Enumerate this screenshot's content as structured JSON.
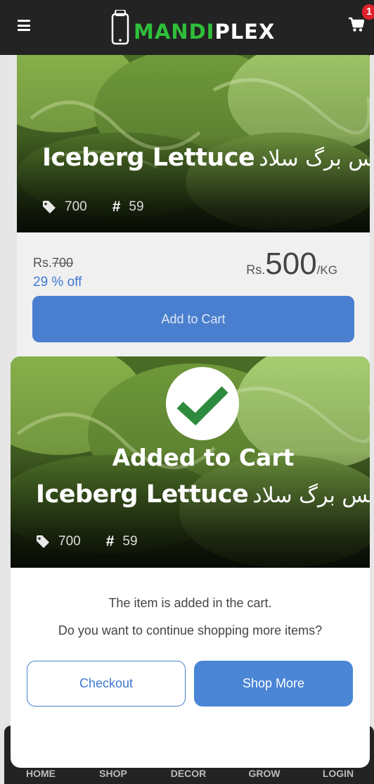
{
  "header": {
    "brand_part1": "MANDI",
    "brand_part2": "PLEX",
    "cart_count": "1",
    "menu_icon": "hamburger-icon",
    "cart_icon": "shopping-cart-icon"
  },
  "product": {
    "name": "Iceberg Lettuce",
    "name_urdu": "آئس برگ سلاد",
    "tag_value": "700",
    "number_value": "59",
    "old_price_prefix": "Rs.",
    "old_price": "700",
    "discount": "29 % off",
    "price_prefix": "Rs.",
    "price": "500",
    "unit": "/KG",
    "add_to_cart_label": "Add to Cart"
  },
  "modal": {
    "heading": "Added to Cart",
    "name": "Iceberg Lettuce",
    "name_urdu": "آئس برگ سلاد",
    "tag_value": "700",
    "number_value": "59",
    "message_line1": "The item is added in the cart.",
    "message_line2": "Do you want to continue shopping more items?",
    "checkout_label": "Checkout",
    "shop_more_label": "Shop More"
  },
  "bottom_nav": {
    "items": [
      {
        "label": "HOME"
      },
      {
        "label": "SHOP"
      },
      {
        "label": "DECOR"
      },
      {
        "label": "GROW"
      },
      {
        "label": "LOGIN"
      }
    ]
  },
  "colors": {
    "header_bg": "#232323",
    "brand_green": "#2fbf3a",
    "primary_blue": "#4a7fcf",
    "badge_red": "#e0202a",
    "check_green": "#2d8a3e"
  }
}
